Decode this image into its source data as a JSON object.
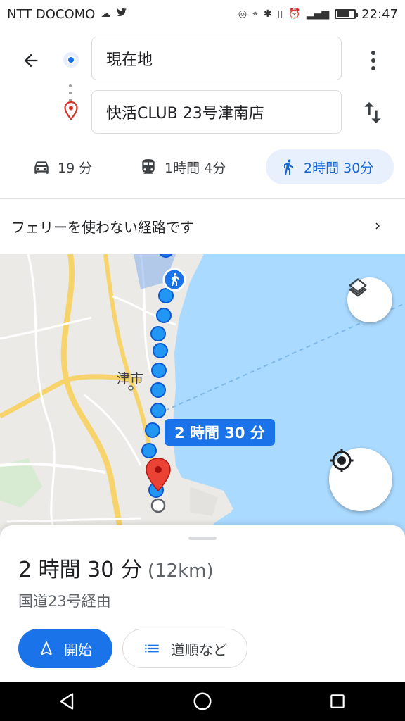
{
  "status_bar": {
    "carrier": "NTT DOCOMO",
    "time": "22:47"
  },
  "search": {
    "origin": "現在地",
    "destination": "快活CLUB 23号津南店"
  },
  "modes": {
    "car": "19 分",
    "transit": "1時間 4分",
    "walk": "2時間 30分"
  },
  "notice": {
    "text": "フェリーを使わない経路です"
  },
  "map": {
    "route_label": "2 時間 30 分",
    "city_label": "津市",
    "route_color": "#1a73e8",
    "destination_pin_color": "#ea4335"
  },
  "sheet": {
    "duration": "2 時間 30 分",
    "distance": "(12km)",
    "via": "国道23号経由",
    "start_label": "開始",
    "steps_label": "道順など"
  },
  "icons": [
    "back-arrow-icon",
    "more-vert-icon",
    "swap-icon",
    "car-icon",
    "train-icon",
    "walk-icon",
    "chevron-right-icon",
    "layers-icon",
    "my-location-icon",
    "navigation-icon",
    "list-icon",
    "back-nav-icon",
    "home-nav-icon",
    "recents-nav-icon"
  ]
}
